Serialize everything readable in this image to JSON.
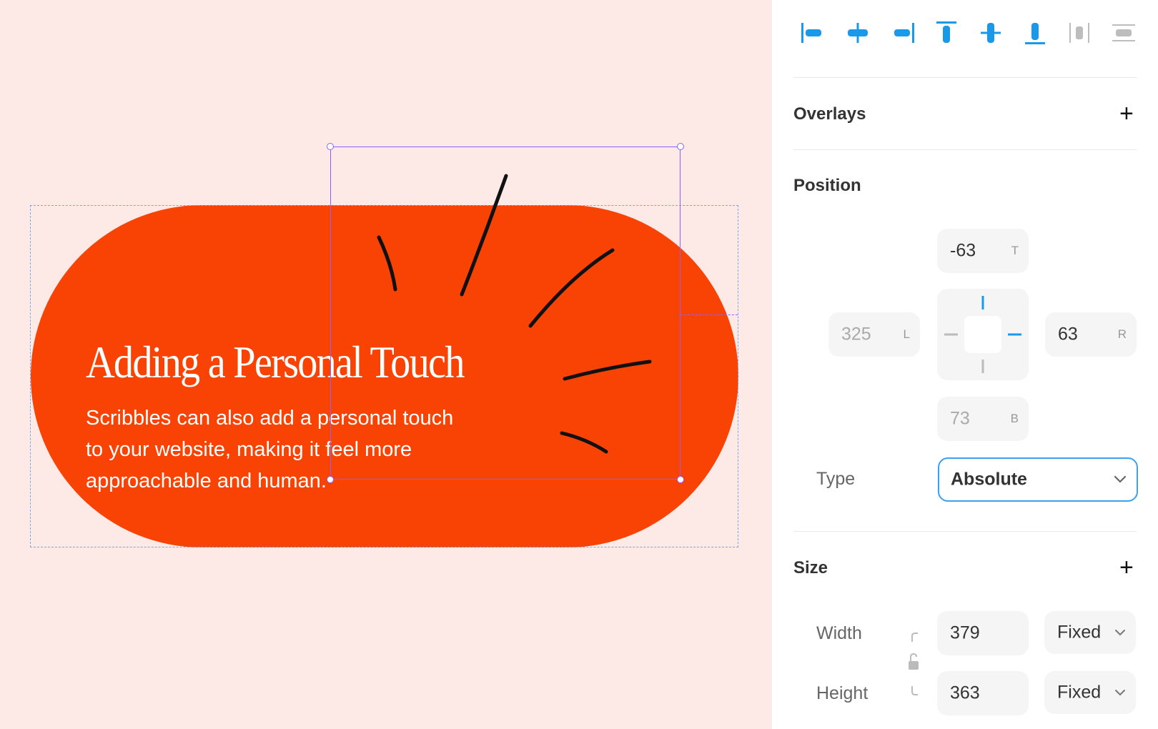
{
  "canvas": {
    "card_color": "#f94304",
    "card": {
      "title": "Adding a Personal Touch",
      "body": "Scribbles can also add a personal touch to your website, making it feel more approachable and human."
    },
    "selection_color": "#8a63ff"
  },
  "panel": {
    "accent": "#1a99ea",
    "align_tools": [
      {
        "name": "align-left-icon"
      },
      {
        "name": "align-horizontal-center-icon"
      },
      {
        "name": "align-right-icon"
      },
      {
        "name": "align-top-icon"
      },
      {
        "name": "align-vertical-center-icon"
      },
      {
        "name": "align-bottom-icon"
      },
      {
        "name": "distribute-horizontal-icon"
      },
      {
        "name": "distribute-vertical-icon"
      }
    ],
    "overlays": {
      "title": "Overlays"
    },
    "position": {
      "title": "Position",
      "top": {
        "value": "-63",
        "suffix": "T"
      },
      "left": {
        "value": "325",
        "suffix": "L"
      },
      "right": {
        "value": "63",
        "suffix": "R"
      },
      "bottom": {
        "value": "73",
        "suffix": "B"
      },
      "type_label": "Type",
      "type_value": "Absolute"
    },
    "size": {
      "title": "Size",
      "width_label": "Width",
      "width_value": "379",
      "width_mode": "Fixed",
      "height_label": "Height",
      "height_value": "363",
      "height_mode": "Fixed"
    }
  }
}
